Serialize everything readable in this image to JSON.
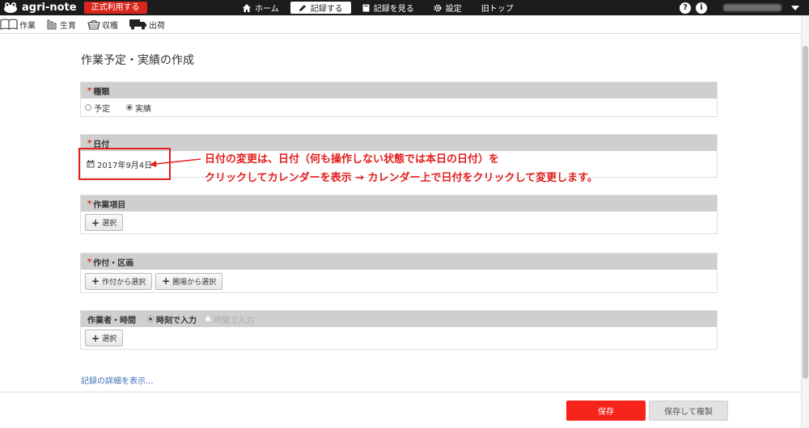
{
  "app": {
    "logo_text": "agri-note",
    "plan_badge": "正式利用する"
  },
  "nav": {
    "items": [
      {
        "label": "ホーム",
        "icon": "home-icon"
      },
      {
        "label": "記録する",
        "icon": "pencil-icon",
        "active": true
      },
      {
        "label": "記録を見る",
        "icon": "notebook-icon"
      },
      {
        "label": "設定",
        "icon": "gear-icon"
      },
      {
        "label": "旧トップ",
        "icon": ""
      }
    ],
    "help_glyph": "?",
    "info_glyph": "i"
  },
  "subnav": {
    "items": [
      {
        "label": "作業",
        "icon": "book-icon"
      },
      {
        "label": "生育",
        "icon": "growth-bars-icon"
      },
      {
        "label": "収穫",
        "icon": "basket-icon"
      },
      {
        "label": "出荷",
        "icon": "truck-icon"
      }
    ]
  },
  "page": {
    "title": "作業予定・実績の作成"
  },
  "form": {
    "required_mark": "*",
    "kind": {
      "label": "種類",
      "options": [
        {
          "label": "予定",
          "checked": false
        },
        {
          "label": "実績",
          "checked": true
        }
      ]
    },
    "date": {
      "label": "日付",
      "value": "2017年9月4日"
    },
    "work_item": {
      "label": "作業項目",
      "select_label": "選択"
    },
    "planting": {
      "label": "作付・区画",
      "buttons": [
        "作付から選択",
        "圃場から選択"
      ]
    },
    "worker_time": {
      "label": "作業者・時間",
      "modes": [
        {
          "label": "時刻で入力",
          "checked": true
        },
        {
          "label": "時間で入力",
          "checked": false
        }
      ],
      "select_label": "選択"
    },
    "details_link": "記録の詳細を表示..."
  },
  "annotation": {
    "line1": "日付の変更は、日付（何も操作しない状態では本日の日付）を",
    "line2": "クリックしてカレンダーを表示 → カレンダー上で日付をクリックして変更します。",
    "color": "#e41e1e"
  },
  "footer": {
    "save_label": "保存",
    "save_dup_label": "保存して複製"
  },
  "colors": {
    "accent": "#f7241c",
    "topbar": "#1c1c1c",
    "section_header": "#cfcfcf",
    "link": "#3d6fb6"
  }
}
